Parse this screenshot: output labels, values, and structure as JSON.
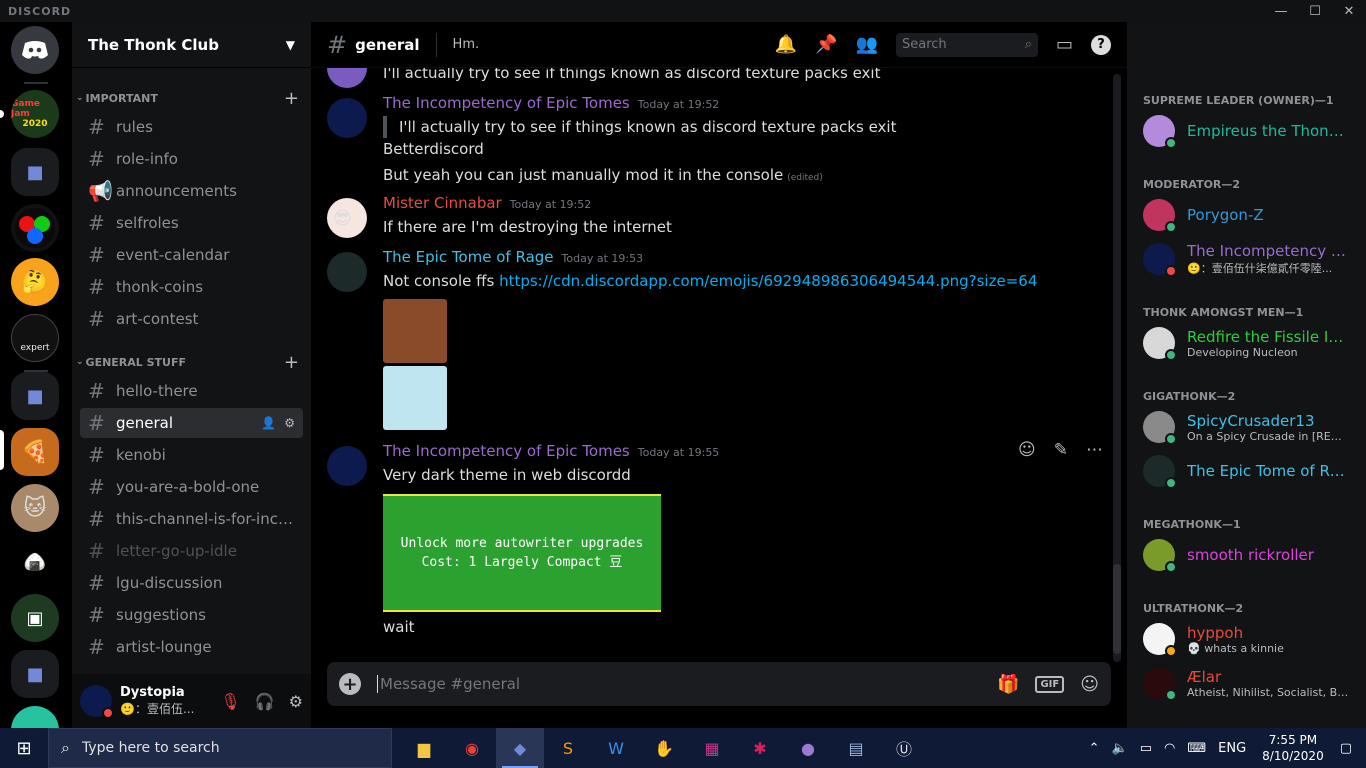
{
  "window": {
    "brand": "DISCORD",
    "minimize": "—",
    "maximize": "☐",
    "close": "✕"
  },
  "server": {
    "name": "The Thonk Club"
  },
  "categories": [
    {
      "label": "IMPORTANT",
      "channels": [
        "rules",
        "role-info",
        "announcements",
        "selfroles",
        "event-calendar",
        "thonk-coins",
        "art-contest"
      ]
    },
    {
      "label": "GENERAL STUFF",
      "channels": [
        "hello-there",
        "general",
        "kenobi",
        "you-are-a-bold-one",
        "this-channel-is-for-incre...",
        "letter-go-up-idle",
        "lgu-discussion",
        "suggestions",
        "artist-lounge"
      ]
    }
  ],
  "servers": {
    "gamejam": [
      "Game Jam",
      "2020"
    ],
    "expert": "expert"
  },
  "user": {
    "name": "Dystopia",
    "status": "🙂：壹佰伍..."
  },
  "chat": {
    "channel": "general",
    "topic": "Hm.",
    "search_placeholder": "Search",
    "composer_placeholder": "Message #general",
    "gif_label": "GIF"
  },
  "messages": {
    "m0": {
      "text": "I'll actually try to see if things known as discord texture packs exit"
    },
    "m1": {
      "author": "The Incompetency of Epic Tomes",
      "time": "Today at 19:52",
      "quote": "I'll actually try to see if things known as discord texture packs exit",
      "lines": [
        "Betterdiscord",
        "But yeah you can just manually mod it in the console"
      ],
      "edited": "(edited)"
    },
    "m2": {
      "author": "Mister Cinnabar",
      "time": "Today at 19:52",
      "text": "If there are I'm destroying the internet"
    },
    "m3": {
      "author": "The Epic Tome of Rage",
      "time": "Today at 19:53",
      "text": "Not console ffs",
      "link": "https://cdn.discordapp.com/emojis/692948986306494544.png?size=64"
    },
    "m4": {
      "author": "The Incompetency of Epic Tomes",
      "time": "Today at 19:55",
      "text": "Very dark theme in web discordd",
      "embed": [
        "Unlock more autowriter upgrades",
        "Cost: 1 Largely Compact 豆"
      ],
      "after": "wait"
    }
  },
  "members": {
    "cats": [
      "SUPREME LEADER (OWNER)—1",
      "MODERATOR—2",
      "THONK AMONGST MEN—1",
      "GIGATHONK—2",
      "MEGATHONK—1",
      "ULTRATHONK—2"
    ],
    "list": [
      {
        "name": "Empireus the Thonkin...",
        "status": ""
      },
      {
        "name": "Porygon-Z",
        "status": ""
      },
      {
        "name": "The Incompetency of ...",
        "status": "🙂：壹佰伍什柒億貳仟零陸..."
      },
      {
        "name": "Redfire the Fissile Isot...",
        "status": "Developing Nucleon"
      },
      {
        "name": "SpicyCrusader13",
        "status": "On a Spicy Crusade in [REDAC..."
      },
      {
        "name": "The Epic Tome of Rage",
        "status": ""
      },
      {
        "name": "smooth rickroller",
        "status": ""
      },
      {
        "name": "hyppoh",
        "status": "💀 whats a kinnie"
      },
      {
        "name": "Ælar",
        "status": "Atheist, Nihilist, Socialist, Bise..."
      }
    ]
  },
  "taskbar": {
    "search_placeholder": "Type here to search",
    "lang": "ENG",
    "time": "7:55 PM",
    "date": "8/10/2020"
  }
}
